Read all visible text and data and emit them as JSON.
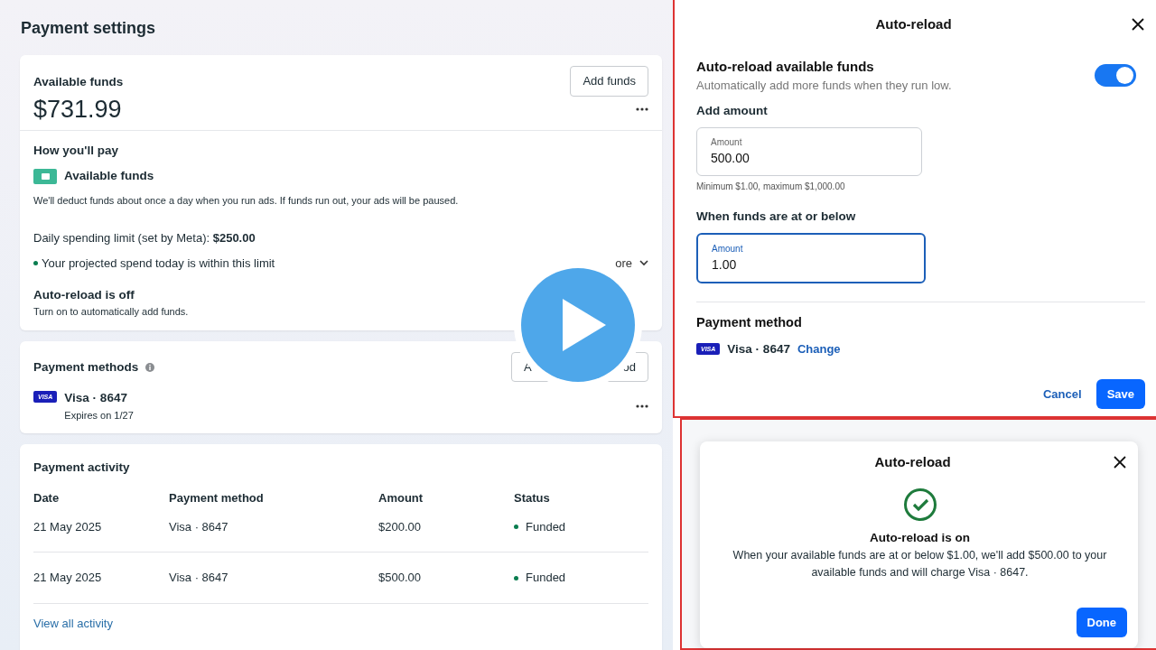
{
  "page_title": "Payment settings",
  "funds_card": {
    "title": "Available funds",
    "add_button": "Add funds",
    "balance": "$731.99"
  },
  "how_you_pay": {
    "heading": "How you'll pay",
    "method": "Available funds",
    "description": "We'll deduct funds about once a day when you run ads. If funds run out, your ads will be paused.",
    "limit": "Daily spending limit (set by Meta): **$250.00**",
    "projection": {
      "text": "Your projected spend today is within this limit",
      "color": "#0a7d4f"
    },
    "see_more": "ore"
  },
  "auto_reload_status": {
    "title": "Auto-reload is off",
    "subtitle": "Turn on to automatically add funds."
  },
  "payment_methods": {
    "title": "Payment methods",
    "add_button_visible": [
      "A",
      "od"
    ],
    "cards": [
      {
        "brand": "VISA",
        "name": "Visa · 8647",
        "expiry": "Expires on 1/27"
      }
    ]
  },
  "payment_activity": {
    "title": "Payment activity",
    "columns": [
      "Date",
      "Payment method",
      "Amount",
      "Status"
    ],
    "rows": [
      {
        "date": "21 May 2025",
        "method": "Visa · 8647",
        "amount": "$200.00",
        "status": "Funded",
        "color": "#0a7d4f"
      },
      {
        "date": "21 May 2025",
        "method": "Visa · 8647",
        "amount": "$500.00",
        "status": "Funded",
        "color": "#0a7d4f"
      }
    ],
    "link": "View all activity"
  },
  "auto_reload_dialog": {
    "title": "Auto-reload",
    "toggle": {
      "label": "Auto-reload available funds",
      "description": "Automatically add more funds when they run low.",
      "on": true
    },
    "add_amount": {
      "label": "Add amount",
      "field_label": "Amount",
      "value": "500.00",
      "hint": "Minimum $1.00, maximum $1,000.00",
      "focused": false
    },
    "threshold": {
      "label": "When funds are at or below",
      "field_label": "Amount",
      "value": "1.00",
      "focused": true
    },
    "payment_heading": "Payment method",
    "card": {
      "brand": "VISA",
      "name": "Visa · 8647"
    },
    "change_link": "Change",
    "cancel": "Cancel",
    "save": "Save"
  },
  "confirmation_dialog": {
    "title": "Auto-reload",
    "heading": "Auto-reload is on",
    "message": "When your available funds are at or below $1.00, we'll add $500.00 to your available funds and will charge Visa · 8647.",
    "done": "Done"
  }
}
